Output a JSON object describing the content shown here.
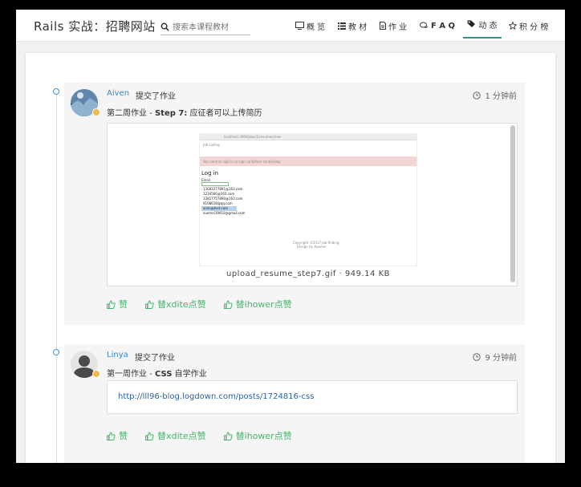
{
  "app": {
    "brand": "Rails 实战：招聘网站",
    "search_placeholder": "搜索本课程教材"
  },
  "nav": [
    {
      "label": "概 览",
      "icon": "monitor-icon"
    },
    {
      "label": "教 材",
      "icon": "list-icon"
    },
    {
      "label": "作 业",
      "icon": "file-icon"
    },
    {
      "label": "F A Q",
      "icon": "chat-icon"
    },
    {
      "label": "动 态",
      "icon": "tag-icon",
      "active": true
    },
    {
      "label": "积 分 榜",
      "icon": "star-icon"
    }
  ],
  "feed": [
    {
      "user": "Aiven",
      "action": "提交了作业",
      "time": "1 分钟前",
      "title_prefix": "第二周作业 - ",
      "title_bold": "Step 7:",
      "title_rest": " 应征者可以上传简历",
      "attachment": {
        "filename": "upload_resume_step7.gif · 949.14 KB",
        "preview": {
          "url": "localhost:3000/jobs/1/resumes/new",
          "app_name": "Job Listing",
          "alert": "You need to sign in or sign up before continuing.",
          "heading": "Log in",
          "email_label": "Email",
          "suggestions": [
            "13683277891@163.com",
            "1234566@163.com",
            "13817757890@163.com",
            "9108618@qq.com",
            "alvin@test.com",
            "xuemei19910@gmail.com"
          ],
          "footer": "Copyright ©2017 Job finding",
          "footer2": "Design by Xuemei"
        }
      },
      "likes": [
        "赞",
        "替xdite点赞",
        "替ihower点赞"
      ]
    },
    {
      "user": "Linya",
      "action": "提交了作业",
      "time": "9 分钟前",
      "title_prefix": "第一周作业 - ",
      "title_bold": "CSS",
      "title_rest": " 自学作业",
      "link": "http://lll96-blog.logdown.com/posts/1724816-css",
      "likes": [
        "赞",
        "替xdite点赞",
        "替ihower点赞"
      ]
    }
  ],
  "colors": {
    "accent": "#2a9a84",
    "like": "#47b36e",
    "link": "#2d5f9a",
    "username": "#3a86c3"
  }
}
